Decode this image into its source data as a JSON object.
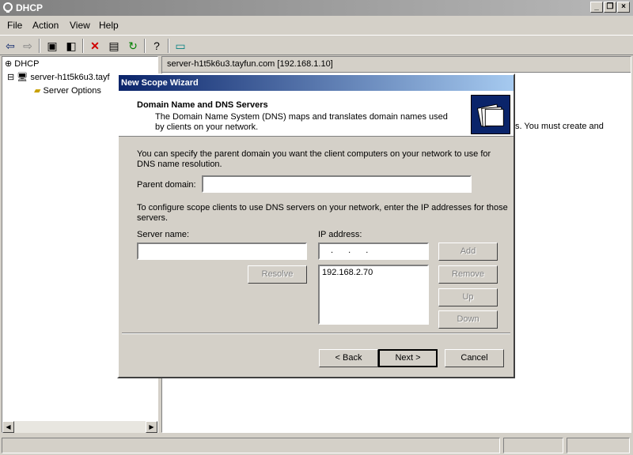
{
  "window": {
    "title": "DHCP"
  },
  "menu": [
    "File",
    "Action",
    "View",
    "Help"
  ],
  "tree": {
    "root": "DHCP",
    "server": "server-h1t5k6u3.tayf",
    "child": "Server Options"
  },
  "right_pane": {
    "header": "server-h1t5k6u3.tayfun.com [192.168.1.10]",
    "partial_text": "s. You must create and"
  },
  "dialog": {
    "title": "New Scope Wizard",
    "heading": "Domain Name and DNS Servers",
    "subheading": "The Domain Name System (DNS) maps and translates domain names used by clients on your network.",
    "intro": "You can specify the parent domain you want the client computers on your network to use for DNS name resolution.",
    "parent_domain_label": "Parent domain:",
    "parent_domain_value": "",
    "configure_text": "To configure scope clients to use DNS servers on your network, enter the IP addresses for those servers.",
    "server_name_label": "Server name:",
    "server_name_value": "",
    "ip_label": "IP address:",
    "ip_input_value": " .  .  . ",
    "ip_list": [
      "192.168.2.70"
    ],
    "buttons": {
      "resolve": "Resolve",
      "add": "Add",
      "remove": "Remove",
      "up": "Up",
      "down": "Down",
      "back": "< Back",
      "next": "Next >",
      "cancel": "Cancel"
    }
  },
  "colors": {
    "title_active": "#0a246a",
    "title_gradient_end": "#a6caf0",
    "title_inactive": "#808080"
  }
}
